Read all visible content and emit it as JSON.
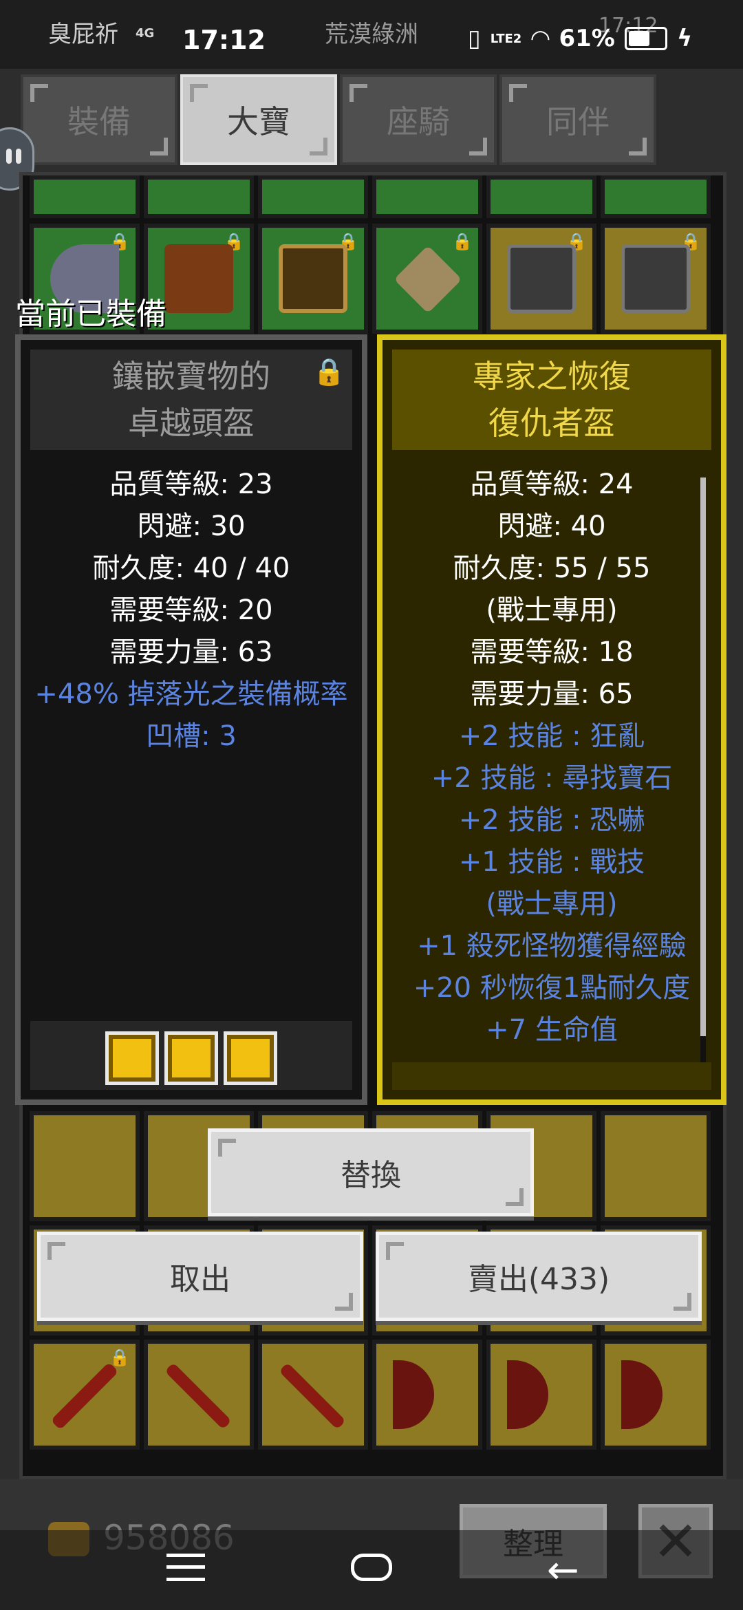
{
  "status_bar": {
    "carrier": "臭屁祈",
    "network": "4G",
    "time": "17:12",
    "app_name": "荒漠綠洲",
    "volte": "LTE2",
    "battery": "61%",
    "ghost_time": "17:12"
  },
  "tabs": [
    {
      "label": "裝備",
      "active": false
    },
    {
      "label": "大寶",
      "active": true
    },
    {
      "label": "座騎",
      "active": false
    },
    {
      "label": "同伴",
      "active": false
    }
  ],
  "equipped_label": "當前已裝備",
  "current_item": {
    "name_line1": "鑲嵌寶物的",
    "name_line2": "卓越頭盔",
    "locked": true,
    "stats": [
      {
        "text": "品質等級: 23",
        "color": "white"
      },
      {
        "text": "閃避: 30",
        "color": "white"
      },
      {
        "text": "耐久度: 40 / 40",
        "color": "white"
      },
      {
        "text": "需要等級: 20",
        "color": "white"
      },
      {
        "text": "需要力量: 63",
        "color": "white"
      },
      {
        "text": "+48% 掉落光之裝備概率",
        "color": "blue"
      },
      {
        "text": "凹槽: 3",
        "color": "blue"
      }
    ],
    "socket_count": 3,
    "gem_color": "#f2c010"
  },
  "new_item": {
    "name_line1": "專家之恢復",
    "name_line2": "復仇者盔",
    "stats": [
      {
        "text": "品質等級: 24",
        "color": "white"
      },
      {
        "text": "閃避: 40",
        "color": "white"
      },
      {
        "text": "耐久度: 55 / 55",
        "color": "white"
      },
      {
        "text": "(戰士專用)",
        "color": "white"
      },
      {
        "text": "需要等級: 18",
        "color": "white"
      },
      {
        "text": "需要力量: 65",
        "color": "white"
      },
      {
        "text": "+2 技能 : 狂亂",
        "color": "blue"
      },
      {
        "text": "+2 技能 : 尋找寶石",
        "color": "blue"
      },
      {
        "text": "+2 技能 : 恐嚇",
        "color": "blue"
      },
      {
        "text": "+1 技能 : 戰技",
        "color": "blue"
      },
      {
        "text": "(戰士專用)",
        "color": "blue"
      },
      {
        "text": "+1 殺死怪物獲得經驗",
        "color": "blue"
      },
      {
        "text": "+20 秒恢復1點耐久度",
        "color": "blue"
      },
      {
        "text": "+7 生命值",
        "color": "blue"
      }
    ]
  },
  "buttons": {
    "replace": "替換",
    "take_out": "取出",
    "sell": "賣出(433)",
    "sort": "整理",
    "close": "✕"
  },
  "gold": "958086",
  "colors": {
    "legendary_border": "#d9c618",
    "legendary_name": "#f0d84a",
    "magic_text": "#5b83e0",
    "green_slot": "#2f7a2f",
    "yellow_slot": "#8d7a22"
  }
}
